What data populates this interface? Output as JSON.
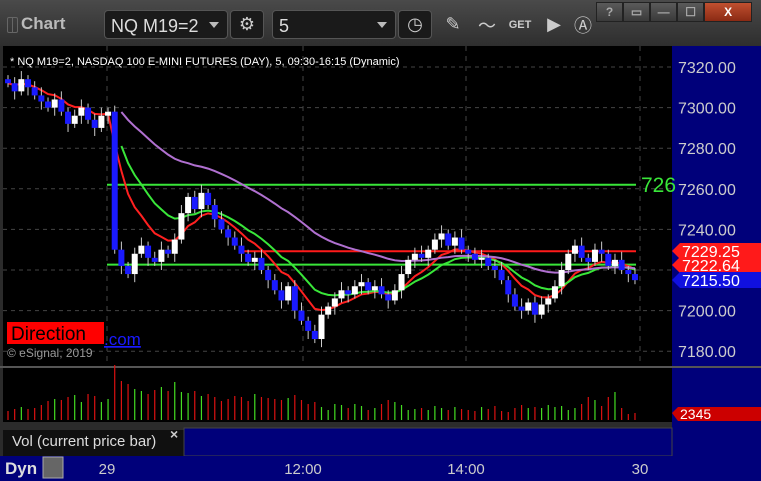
{
  "window": {
    "title": "Chart",
    "symbol": "NQ M19=2",
    "interval": "5",
    "buttons": [
      "?",
      "▭",
      "—",
      "☐",
      "X"
    ]
  },
  "chart": {
    "legend": "* NQ M19=2, NASDAQ 100 E-MINI FUTURES (DAY), 5, 09:30-16:15 (Dynamic)",
    "watermark": "Direction",
    "watermark_link": ".com",
    "copyright": "© eSignal, 2019",
    "line_label": "726",
    "price_labels": [
      {
        "text": "7229.25",
        "value": 7229.25,
        "color": "#ff1a1a"
      },
      {
        "text": "7222.64",
        "value": 7222.64,
        "color": "#ff1a1a"
      },
      {
        "text": "7215.50",
        "value": 7215.5,
        "color": "#1010e0"
      }
    ],
    "volume_label": "2345",
    "volume_study": "Vol (current price bar)",
    "dyn": "Dyn",
    "colors": {
      "up": "#ffffff",
      "down": "#1a1aff",
      "ma_fast": "#ff2020",
      "ma_slow": "#39e639",
      "ma_long": "#b070d0",
      "axis_bg": "#00007a",
      "vol_up": "#44dd22",
      "vol_down": "#dd1111"
    }
  },
  "chart_data": {
    "type": "candlestick",
    "y_ticks": [
      "7320.00",
      "7300.00",
      "7280.00",
      "7260.00",
      "7240.00",
      "7220.00",
      "7200.00",
      "7180.00"
    ],
    "ylim": [
      7175,
      7330
    ],
    "x_ticks": [
      "29",
      "12:00",
      "14:00",
      "30"
    ],
    "horizontal_lines": [
      {
        "value": 7262,
        "color": "#39e639"
      },
      {
        "value": 7229.25,
        "color": "#ff1a1a"
      },
      {
        "value": 7222.64,
        "color": "#39e639"
      }
    ],
    "closes": [
      7312,
      7308,
      7314,
      7310,
      7306,
      7303,
      7300,
      7304,
      7298,
      7292,
      7296,
      7300,
      7294,
      7290,
      7296,
      7298,
      7230,
      7222,
      7218,
      7228,
      7232,
      7226,
      7224,
      7230,
      7228,
      7235,
      7248,
      7256,
      7250,
      7258,
      7252,
      7245,
      7240,
      7236,
      7232,
      7228,
      7224,
      7226,
      7220,
      7215,
      7210,
      7205,
      7212,
      7200,
      7195,
      7190,
      7186,
      7198,
      7202,
      7206,
      7210,
      7208,
      7212,
      7214,
      7210,
      7212,
      7208,
      7205,
      7210,
      7218,
      7225,
      7228,
      7226,
      7230,
      7235,
      7238,
      7232,
      7236,
      7230,
      7228,
      7225,
      7226,
      7222,
      7220,
      7215,
      7208,
      7202,
      7200,
      7204,
      7198,
      7203,
      7206,
      7212,
      7220,
      7228,
      7232,
      7226,
      7224,
      7230,
      7228,
      7222,
      7225,
      7220,
      7218,
      7215
    ],
    "volume": [
      900,
      1100,
      1300,
      1100,
      1200,
      1500,
      1900,
      2100,
      2000,
      2300,
      2500,
      1800,
      2600,
      2400,
      1800,
      2100,
      5500,
      3900,
      3600,
      3100,
      2900,
      2600,
      3000,
      3300,
      2900,
      3800,
      2800,
      2700,
      2900,
      2400,
      2600,
      2300,
      1900,
      2100,
      2400,
      2300,
      1900,
      2600,
      2300,
      2200,
      2100,
      2000,
      2200,
      2500,
      2000,
      1600,
      1800,
      1300,
      1000,
      1600,
      1500,
      1200,
      1600,
      1400,
      1000,
      1200,
      1600,
      2000,
      1800,
      1500,
      1000,
      1100,
      1200,
      1000,
      1400,
      1200,
      1000,
      1300,
      1100,
      1000,
      900,
      1300,
      1100,
      1400,
      900,
      800,
      1200,
      1500,
      1200,
      1300,
      1200,
      1500,
      1300,
      1400,
      1000,
      1200,
      1600,
      2300,
      2000,
      1400,
      2300,
      2800,
      1200,
      600,
      700
    ]
  }
}
